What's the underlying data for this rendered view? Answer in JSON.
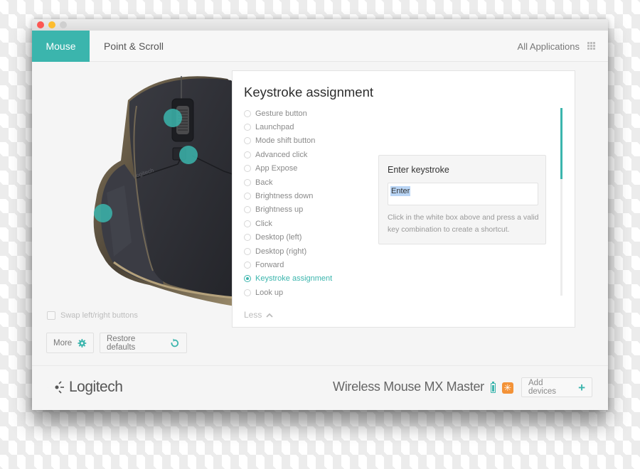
{
  "window": {
    "controls": [
      "close",
      "minimize",
      "maximize"
    ]
  },
  "tabs": [
    {
      "label": "Mouse",
      "active": true
    },
    {
      "label": "Point & Scroll",
      "active": false
    }
  ],
  "all_applications": {
    "label": "All Applications",
    "icon": "grid-icon"
  },
  "mouse_image": {
    "alt": "MX Master mouse",
    "hotspots": [
      "thumbwheel",
      "mode-shift-button",
      "gesture-button"
    ]
  },
  "swap_buttons": {
    "label": "Swap left/right buttons",
    "checked": false
  },
  "buttons": {
    "more": "More",
    "more_icon": "gear-icon",
    "restore": "Restore defaults",
    "restore_icon": "refresh-icon"
  },
  "panel": {
    "title": "Keystroke assignment",
    "options": [
      {
        "label": "Gesture button",
        "selected": false
      },
      {
        "label": "Launchpad",
        "selected": false
      },
      {
        "label": "Mode shift button",
        "selected": false
      },
      {
        "label": "Advanced click",
        "selected": false
      },
      {
        "label": "App Expose",
        "selected": false
      },
      {
        "label": "Back",
        "selected": false
      },
      {
        "label": "Brightness down",
        "selected": false
      },
      {
        "label": "Brightness up",
        "selected": false
      },
      {
        "label": "Click",
        "selected": false
      },
      {
        "label": "Desktop (left)",
        "selected": false
      },
      {
        "label": "Desktop (right)",
        "selected": false
      },
      {
        "label": "Forward",
        "selected": false
      },
      {
        "label": "Keystroke assignment",
        "selected": true
      },
      {
        "label": "Look up",
        "selected": false
      }
    ],
    "less_label": "Less",
    "keystroke": {
      "title": "Enter keystroke",
      "value": "Enter",
      "help": "Click in the white box above and press a valid key combination to create a shortcut."
    }
  },
  "footer": {
    "brand": "Logitech",
    "device_name": "Wireless Mouse MX Master",
    "battery_icon": "battery-icon",
    "flow_icon": "flow-icon",
    "add_devices": "Add devices"
  },
  "colors": {
    "accent": "#3bb5ad",
    "flow": "#f39237",
    "selection": "#b9d5f5"
  }
}
